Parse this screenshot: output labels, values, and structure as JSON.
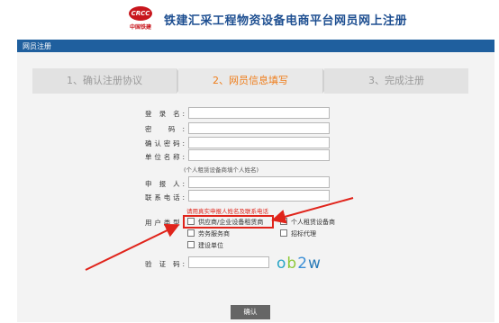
{
  "header": {
    "logo_text": "中国铁建",
    "logo_mark": "CRCC",
    "title": "铁建汇采工程物资设备电商平台网员网上注册"
  },
  "section_bar": {
    "label": "网员注册"
  },
  "steps": [
    {
      "label": "1、确认注册协议",
      "state": "done"
    },
    {
      "label": "2、网员信息填写",
      "state": "active"
    },
    {
      "label": "3、完成注册",
      "state": "pending"
    }
  ],
  "form": {
    "login_name_label": "登 录 名:",
    "password_label": "密   码:",
    "confirm_password_label": "确认密码:",
    "company_name_label": "单位名称:",
    "company_name_hint": "(个人租赁设备商填个人姓名)",
    "applicant_label": "申 报 人:",
    "contact_phone_label": "联系电话:",
    "applicant_hint": "请用真实申报人姓名及联系电话",
    "user_type_label": "用户类型:",
    "user_type_options": [
      "供应商/企业设备租赁商",
      "个人租赁设备商",
      "劳务服务商",
      "招标代理",
      "建设单位"
    ],
    "captcha_label": "验 证 码:",
    "captcha_text": "ob2w",
    "submit_label": "确认"
  },
  "colors": {
    "brand_blue": "#1e4f91",
    "bar_blue": "#1f5f9e",
    "active_step": "#ef7d1a",
    "annotation_red": "#e0241b"
  }
}
